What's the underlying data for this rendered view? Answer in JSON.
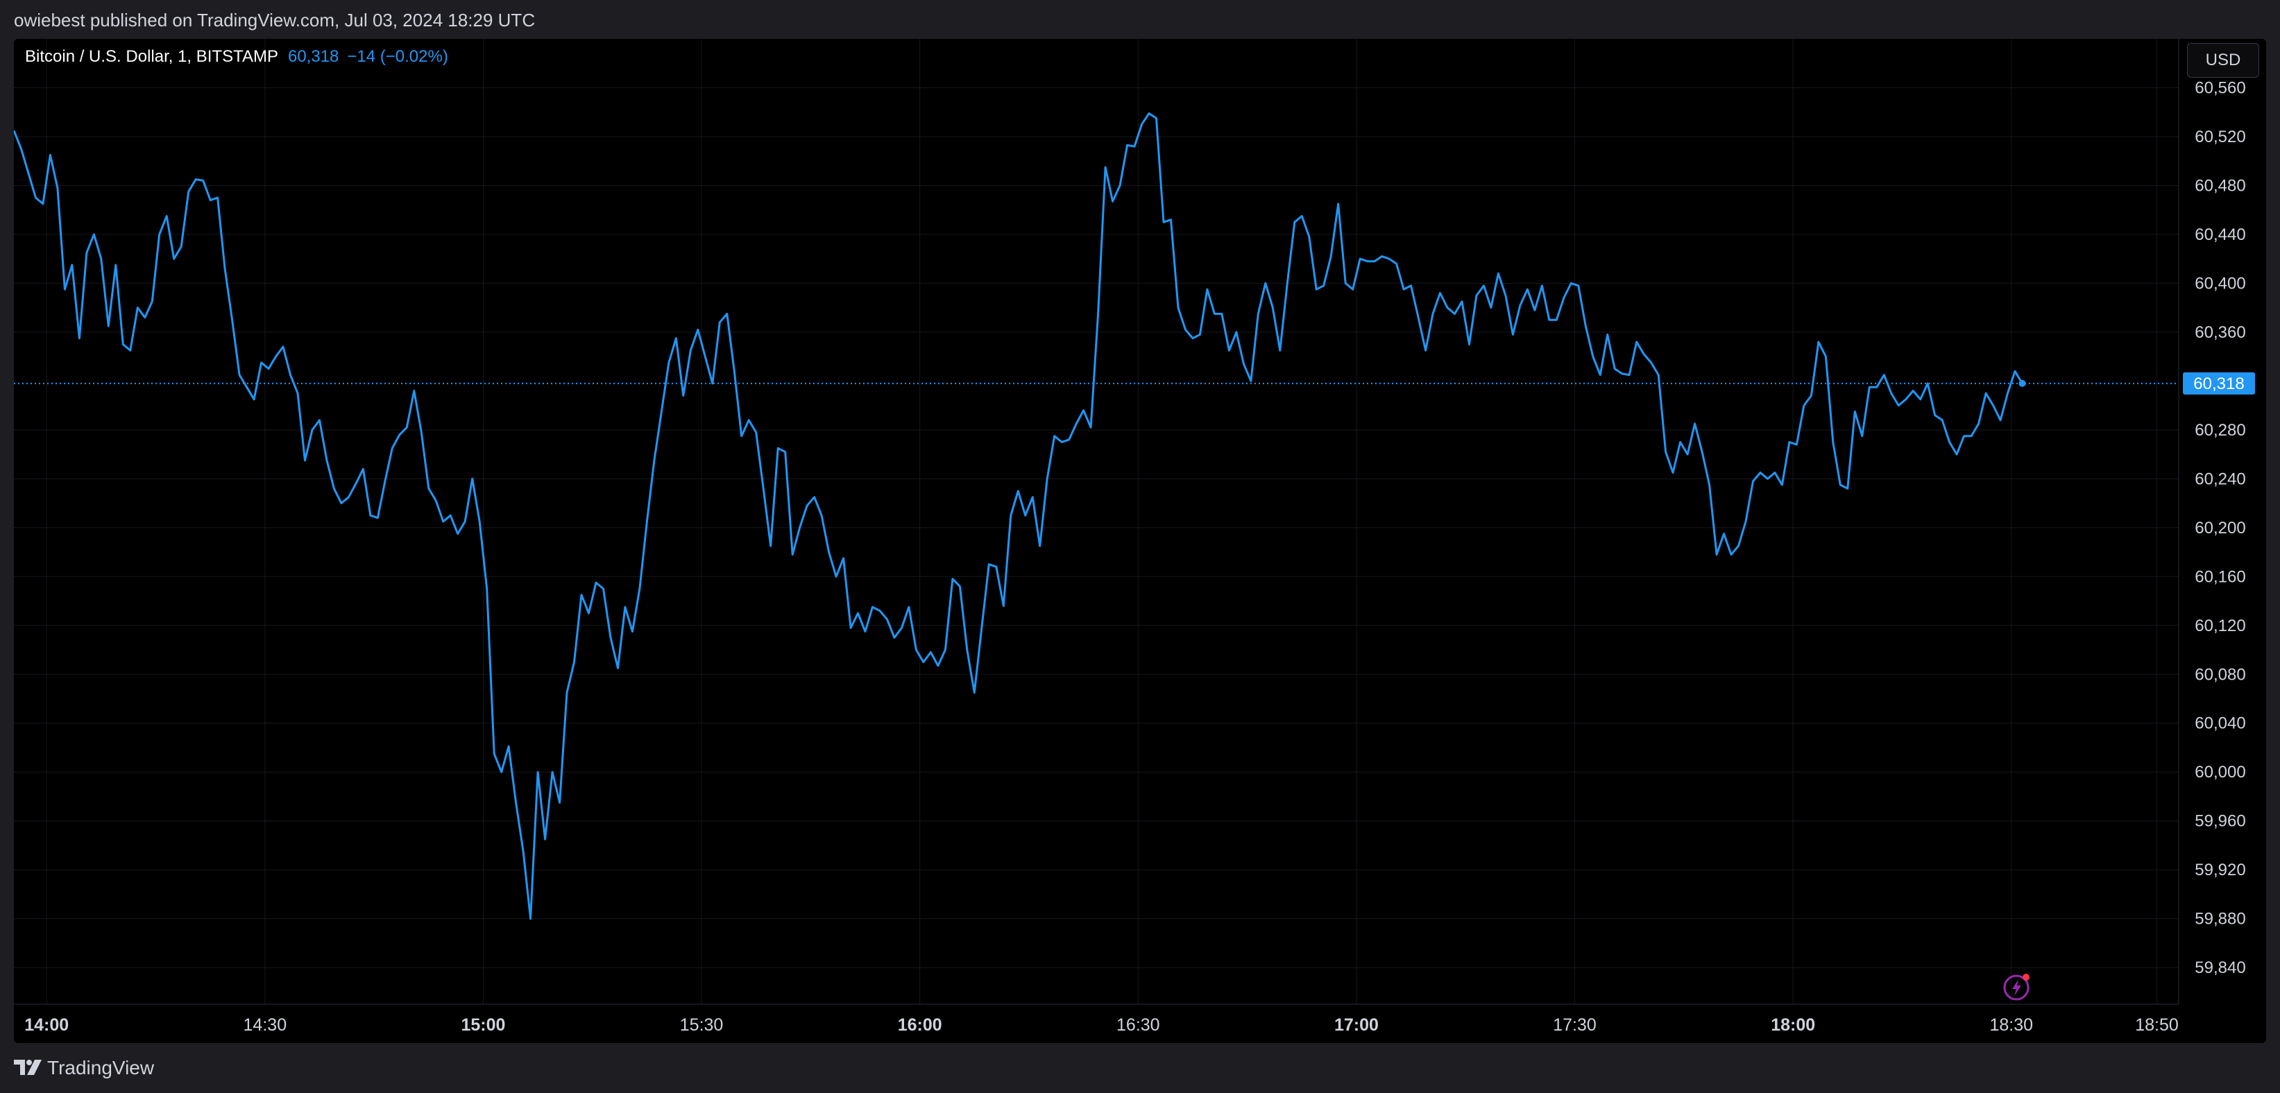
{
  "header": {
    "published": "owiebest published on TradingView.com, Jul 03, 2024 18:29 UTC"
  },
  "legend": {
    "symbol": "Bitcoin / U.S. Dollar, 1, BITSTAMP",
    "price": "60,318",
    "change": "−14 (−0.02%)"
  },
  "currency_button": "USD",
  "last_price_label": "60,318",
  "footer": {
    "brand": "TradingView"
  },
  "colors": {
    "line": "#2196f3",
    "background": "#000000",
    "grid": "#16181d",
    "axis_text": "#d1d4dc",
    "alert_icon": "#9c27b0"
  },
  "icons": {
    "alert": "lightning-bolt-icon",
    "logo": "tradingview-logo-icon"
  },
  "chart_data": {
    "type": "line",
    "title": "",
    "xlabel": "",
    "ylabel": "",
    "x_ticks": [
      {
        "label": "14:00",
        "minute": 0,
        "bold": true
      },
      {
        "label": "14:30",
        "minute": 30,
        "bold": false
      },
      {
        "label": "15:00",
        "minute": 60,
        "bold": true
      },
      {
        "label": "15:30",
        "minute": 90,
        "bold": false
      },
      {
        "label": "16:00",
        "minute": 120,
        "bold": true
      },
      {
        "label": "16:30",
        "minute": 150,
        "bold": false
      },
      {
        "label": "17:00",
        "minute": 180,
        "bold": true
      },
      {
        "label": "17:30",
        "minute": 210,
        "bold": false
      },
      {
        "label": "18:00",
        "minute": 240,
        "bold": true
      },
      {
        "label": "18:30",
        "minute": 270,
        "bold": false
      },
      {
        "label": "18:50",
        "minute": 290,
        "bold": false
      }
    ],
    "y_ticks": [
      "60,560",
      "60,520",
      "60,480",
      "60,440",
      "60,400",
      "60,360",
      "60,280",
      "60,240",
      "60,200",
      "60,160",
      "60,120",
      "60,080",
      "60,040",
      "60,000",
      "59,960",
      "59,920",
      "59,880",
      "59,840"
    ],
    "y_tick_values": [
      60560,
      60520,
      60480,
      60440,
      60400,
      60360,
      60280,
      60240,
      60200,
      60160,
      60120,
      60080,
      60040,
      60000,
      59960,
      59920,
      59880,
      59840
    ],
    "ylim": [
      59810,
      60600
    ],
    "xlim_minutes": [
      -4.5,
      293
    ],
    "last_price": 60318,
    "series": [
      {
        "name": "",
        "x_start_minute": -4.5,
        "x_step_minutes": 1,
        "values": [
          60525,
          60510,
          60490,
          60470,
          60465,
          60505,
          60478,
          60395,
          60415,
          60355,
          60425,
          60440,
          60420,
          60365,
          60415,
          60350,
          60345,
          60380,
          60372,
          60385,
          60440,
          60455,
          60420,
          60430,
          60475,
          60485,
          60484,
          60468,
          60470,
          60412,
          60370,
          60325,
          60315,
          60305,
          60335,
          60330,
          60340,
          60348,
          60325,
          60310,
          60255,
          60280,
          60288,
          60255,
          60232,
          60220,
          60225,
          60236,
          60248,
          60210,
          60208,
          60238,
          60265,
          60276,
          60282,
          60312,
          60278,
          60232,
          60222,
          60205,
          60210,
          60195,
          60205,
          60240,
          60205,
          60150,
          60015,
          60000,
          60021,
          59975,
          59935,
          59880,
          60000,
          59945,
          60000,
          59975,
          60065,
          60090,
          60145,
          60130,
          60155,
          60150,
          60110,
          60085,
          60135,
          60115,
          60150,
          60205,
          60255,
          60295,
          60335,
          60355,
          60308,
          60345,
          60362,
          60340,
          60318,
          60368,
          60375,
          60328,
          60275,
          60288,
          60278,
          60232,
          60185,
          60265,
          60262,
          60178,
          60200,
          60218,
          60225,
          60210,
          60180,
          60160,
          60175,
          60118,
          60130,
          60115,
          60135,
          60132,
          60125,
          60110,
          60118,
          60135,
          60100,
          60090,
          60098,
          60087,
          60100,
          60158,
          60152,
          60100,
          60065,
          60118,
          60170,
          60168,
          60136,
          60210,
          60230,
          60210,
          60225,
          60185,
          60240,
          60275,
          60270,
          60272,
          60285,
          60296,
          60282,
          60375,
          60495,
          60467,
          60480,
          60513,
          60512,
          60530,
          60539,
          60535,
          60450,
          60452,
          60380,
          60362,
          60355,
          60358,
          60395,
          60375,
          60375,
          60345,
          60360,
          60334,
          60320,
          60375,
          60400,
          60380,
          60345,
          60400,
          60450,
          60455,
          60438,
          60395,
          60398,
          60422,
          60465,
          60400,
          60395,
          60420,
          60418,
          60418,
          60422,
          60420,
          60416,
          60395,
          60398,
          60372,
          60345,
          60375,
          60392,
          60380,
          60375,
          60385,
          60350,
          60390,
          60398,
          60380,
          60408,
          60390,
          60358,
          60382,
          60395,
          60378,
          60398,
          60370,
          60370,
          60388,
          60400,
          60398,
          60365,
          60340,
          60325,
          60358,
          60330,
          60326,
          60325,
          60352,
          60342,
          60335,
          60325,
          60262,
          60245,
          60270,
          60260,
          60285,
          60262,
          60235,
          60178,
          60195,
          60178,
          60185,
          60205,
          60238,
          60245,
          60240,
          60245,
          60235,
          60270,
          60268,
          60300,
          60308,
          60352,
          60340,
          60270,
          60235,
          60232,
          60295,
          60275,
          60315,
          60315,
          60325,
          60310,
          60300,
          60305,
          60312,
          60305,
          60318,
          60292,
          60288,
          60270,
          60260,
          60275,
          60275,
          60285,
          60310,
          60300,
          60288,
          60310,
          60328,
          60318
        ]
      }
    ]
  }
}
